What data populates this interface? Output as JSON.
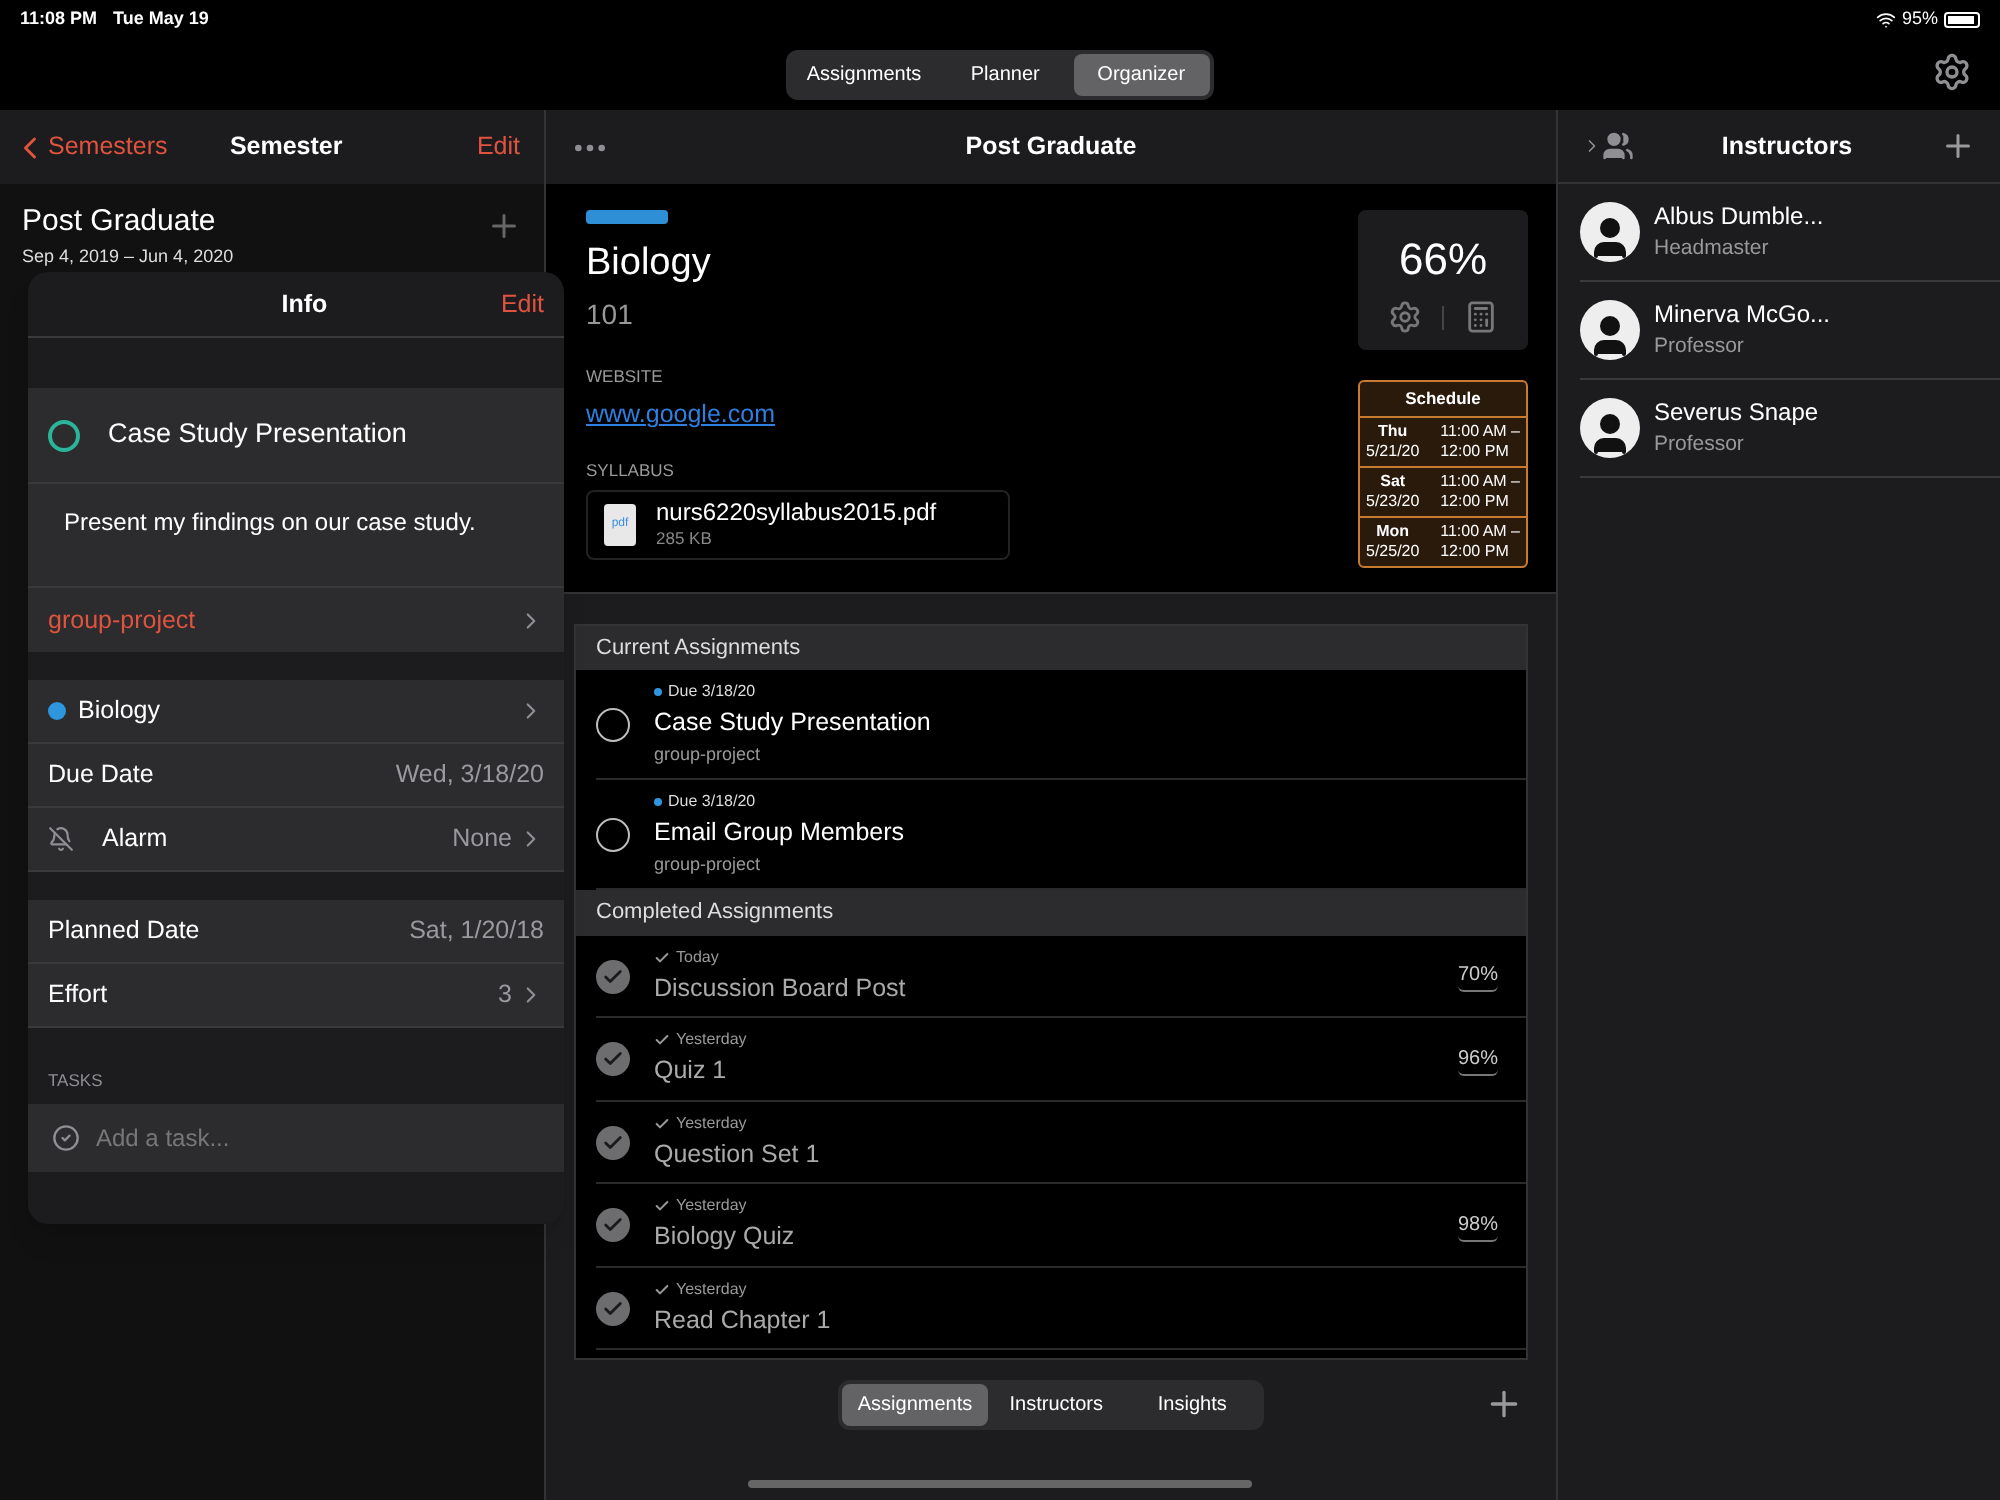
{
  "status_bar": {
    "time": "11:08 PM",
    "date": "Tue May 19",
    "battery": "95%"
  },
  "top_tabs": [
    {
      "label": "Assignments",
      "selected": false
    },
    {
      "label": "Planner",
      "selected": false
    },
    {
      "label": "Organizer",
      "selected": true
    }
  ],
  "semester_panel": {
    "back": "Semesters",
    "title": "Semester",
    "edit": "Edit",
    "name": "Post Graduate",
    "dates": "Sep 4, 2019 – Jun 4, 2020"
  },
  "info_popover": {
    "title": "Info",
    "edit": "Edit",
    "assignment": "Case Study Presentation",
    "done": false,
    "description": "Present my findings on our case study.",
    "tag": "group-project",
    "rows": [
      {
        "kind": "course",
        "label": "Biology",
        "chevron": true,
        "color": "#2f95dc"
      },
      {
        "label": "Due Date",
        "value": "Wed, 3/18/20",
        "chevron": false
      },
      {
        "kind": "alarm",
        "label": "Alarm",
        "value": "None",
        "chevron": true
      }
    ],
    "rows_2": [
      {
        "label": "Planned Date",
        "value": "Sat, 1/20/18",
        "chevron": false
      },
      {
        "label": "Effort",
        "value": "3",
        "chevron": true
      }
    ],
    "tasks_header": "TASKS",
    "task_placeholder": "Add a task..."
  },
  "course_panel": {
    "title": "Post Graduate",
    "color": "#2f8fd6",
    "name": "Biology",
    "number": "101",
    "website_label": "WEBSITE",
    "website": "www.google.com",
    "syllabus_label": "SYLLABUS",
    "file_name": "nurs6220syllabus2015.pdf",
    "file_size": "285 KB",
    "file_icon": "pdf",
    "grade": "66%",
    "schedule_title": "Schedule",
    "schedule": [
      {
        "day": "Thu",
        "date": "5/21/20",
        "start": "11:00 AM –",
        "end": "12:00 PM"
      },
      {
        "day": "Sat",
        "date": "5/23/20",
        "start": "11:00 AM –",
        "end": "12:00 PM"
      },
      {
        "day": "Mon",
        "date": "5/25/20",
        "start": "11:00 AM –",
        "end": "12:00 PM"
      }
    ]
  },
  "current_header": "Current Assignments",
  "current_assignments": [
    {
      "due": "Due 3/18/20",
      "color": "#2f95dc",
      "title": "Case Study Presentation",
      "tag": "group-project",
      "checked": false
    },
    {
      "due": "Due 3/18/20",
      "color": "#2f95dc",
      "title": "Email Group Members",
      "tag": "group-project",
      "checked": false
    }
  ],
  "completed_header": "Completed Assignments",
  "completed_assignments": [
    {
      "when": "Today",
      "title": "Discussion Board Post",
      "score": "70%",
      "checked": true
    },
    {
      "when": "Yesterday",
      "title": "Quiz 1",
      "score": "96%",
      "checked": true
    },
    {
      "when": "Yesterday",
      "title": "Question Set 1",
      "checked": true
    },
    {
      "when": "Yesterday",
      "title": "Biology Quiz",
      "score": "98%",
      "checked": true
    },
    {
      "when": "Yesterday",
      "title": "Read Chapter 1",
      "checked": true
    }
  ],
  "bottom_tabs": [
    {
      "label": "Assignments",
      "selected": true
    },
    {
      "label": "Instructors",
      "selected": false
    },
    {
      "label": "Insights",
      "selected": false
    }
  ],
  "instructors_panel": {
    "title": "Instructors",
    "items": [
      {
        "name": "Albus Dumble...",
        "role": "Headmaster"
      },
      {
        "name": "Minerva McGo...",
        "role": "Professor"
      },
      {
        "name": "Severus Snape",
        "role": "Professor"
      }
    ]
  }
}
